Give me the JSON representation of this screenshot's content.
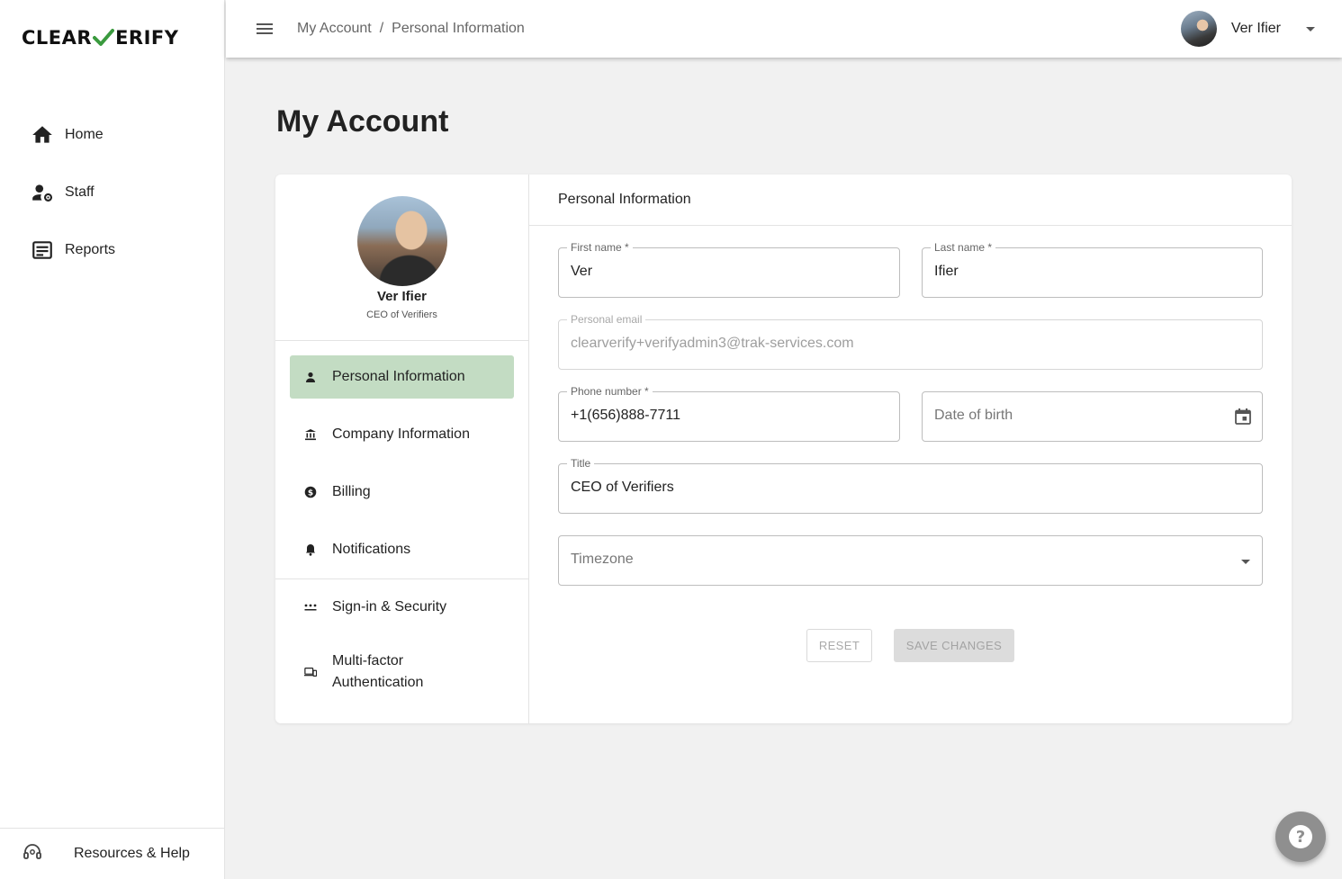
{
  "brand": {
    "logo_left": "CLEAR",
    "logo_right": "ERIFY",
    "check_color": "#3a9a3e"
  },
  "sidebar": {
    "items": [
      {
        "label": "Home",
        "icon": "home-icon"
      },
      {
        "label": "Staff",
        "icon": "staff-settings-icon"
      },
      {
        "label": "Reports",
        "icon": "reports-icon"
      }
    ],
    "footer": {
      "label": "Resources & Help",
      "icon": "headset-icon"
    }
  },
  "topbar": {
    "breadcrumb": [
      "My Account",
      "Personal Information"
    ],
    "breadcrumb_separator": "/",
    "user_name": "Ver Ifier"
  },
  "page": {
    "title": "My Account"
  },
  "profile": {
    "name": "Ver Ifier",
    "title": "CEO of Verifiers"
  },
  "account_menu": {
    "group1": [
      {
        "label": "Personal Information",
        "icon": "person-icon",
        "active": true
      },
      {
        "label": "Company Information",
        "icon": "bank-icon",
        "active": false
      },
      {
        "label": "Billing",
        "icon": "dollar-icon",
        "active": false
      },
      {
        "label": "Notifications",
        "icon": "bell-icon",
        "active": false
      }
    ],
    "group2": [
      {
        "label": "Sign-in & Security",
        "icon": "password-icon"
      },
      {
        "label": "Multi-factor Authentication",
        "icon": "devices-icon"
      }
    ]
  },
  "form": {
    "section_title": "Personal Information",
    "first_name": {
      "label": "First name *",
      "value": "Ver"
    },
    "last_name": {
      "label": "Last name *",
      "value": "Ifier"
    },
    "email": {
      "label": "Personal email",
      "value": "clearverify+verifyadmin3@trak-services.com"
    },
    "phone": {
      "label": "Phone number *",
      "value": "+1(656)888-7711"
    },
    "dob": {
      "placeholder": "Date of birth"
    },
    "title": {
      "label": "Title",
      "value": "CEO of Verifiers"
    },
    "timezone": {
      "placeholder": "Timezone"
    },
    "reset_label": "RESET",
    "save_label": "SAVE CHANGES"
  },
  "colors": {
    "active_menu_bg": "#c3dcc3",
    "background": "#f1f1f1"
  }
}
